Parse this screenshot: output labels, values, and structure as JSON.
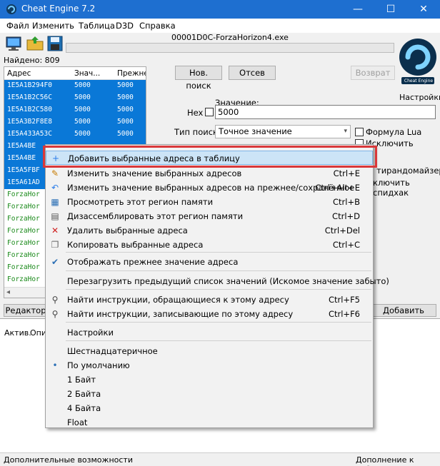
{
  "window": {
    "title": "Cheat Engine 7.2",
    "min": "—",
    "max": "☐",
    "close": "✕"
  },
  "menu": [
    "Файл",
    "Изменить",
    "Таблица",
    "D3D",
    "Справка"
  ],
  "process_name": "00001D0C-ForzaHorizon4.exe",
  "found": "Найдено: 809",
  "logo_text": "Cheat Engine",
  "settings_label": "Настройки",
  "results": {
    "headers": [
      "Адрес",
      "Знач...",
      "Прежне..."
    ],
    "rows": [
      {
        "addr": "1E5A1B294F0",
        "val": "5000",
        "prev": "5000",
        "selected": true
      },
      {
        "addr": "1E5A1B2C56C",
        "val": "5000",
        "prev": "5000",
        "selected": true
      },
      {
        "addr": "1E5A1B2C580",
        "val": "5000",
        "prev": "5000",
        "selected": true
      },
      {
        "addr": "1E5A3B2F8E8",
        "val": "5000",
        "prev": "5000",
        "selected": true
      },
      {
        "addr": "1E5A433A53C",
        "val": "5000",
        "prev": "5000",
        "selected": true
      },
      {
        "addr": "1E5A4BE",
        "val": "",
        "prev": "",
        "selected": true
      },
      {
        "addr": "1E5A4BE",
        "val": "",
        "prev": "",
        "selected": true
      },
      {
        "addr": "1E5A5FBF",
        "val": "",
        "prev": "",
        "selected": true
      },
      {
        "addr": "1E5A61AD",
        "val": "",
        "prev": "",
        "selected": true
      },
      {
        "addr": "ForzaHor",
        "val": "",
        "prev": "",
        "selected": false
      },
      {
        "addr": "ForzaHor",
        "val": "",
        "prev": "",
        "selected": false
      },
      {
        "addr": "ForzaHor",
        "val": "",
        "prev": "",
        "selected": false
      },
      {
        "addr": "ForzaHor",
        "val": "",
        "prev": "",
        "selected": false
      },
      {
        "addr": "ForzaHor",
        "val": "",
        "prev": "",
        "selected": false
      },
      {
        "addr": "ForzaHor",
        "val": "",
        "prev": "",
        "selected": false
      },
      {
        "addr": "ForzaHor",
        "val": "",
        "prev": "",
        "selected": false
      },
      {
        "addr": "ForzaHor",
        "val": "",
        "prev": "",
        "selected": false
      }
    ]
  },
  "buttons": {
    "new_scan": "Нов. поиск",
    "next_scan": "Отсев",
    "undo_scan": "Возврат",
    "editor": "Редактор",
    "add_address": "Добавить адрес"
  },
  "scan": {
    "value_label": "Значение:",
    "hex_label": "Hex",
    "value": "5000",
    "scan_type_label": "Тип поиска",
    "scan_type": "Точное значение",
    "lua_formula": "Формула Lua",
    "exclude": "Исключить",
    "randomizer": "тирандомайзер",
    "speedhack": "ключить спидхак"
  },
  "bottom": {
    "headers": [
      "Актив.",
      "Опи"
    ]
  },
  "status": {
    "left": "Дополнительные возможности",
    "right": "Дополнение к таблицу"
  },
  "context_menu": {
    "items": [
      {
        "icon": "+",
        "label": "Добавить выбранные адреса в таблицу",
        "shortcut": ""
      },
      {
        "icon": "✎",
        "label": "Изменить значение выбранных адресов",
        "shortcut": "Ctrl+E"
      },
      {
        "icon": "↶",
        "label": "Изменить значение выбранных адресов на прежнее/сохранённое",
        "shortcut": "Ctrl+Alt+E"
      },
      {
        "icon": "▦",
        "label": "Просмотреть этот регион памяти",
        "shortcut": "Ctrl+B"
      },
      {
        "icon": "▤",
        "label": "Дизассемблировать этот регион памяти",
        "shortcut": "Ctrl+D"
      },
      {
        "icon": "✕",
        "label": "Удалить выбранные адреса",
        "shortcut": "Ctrl+Del"
      },
      {
        "icon": "❐",
        "label": "Копировать выбранные адреса",
        "shortcut": "Ctrl+C"
      },
      {
        "icon": "✔",
        "label": "Отображать прежнее значение адреса",
        "shortcut": ""
      },
      {
        "icon": "",
        "label": "Перезагрузить предыдущий список значений (Искомое значение забыто)",
        "shortcut": ""
      },
      {
        "icon": "⚲",
        "label": "Найти инструкции, обращающиеся к этому адресу",
        "shortcut": "Ctrl+F5"
      },
      {
        "icon": "⚲",
        "label": "Найти инструкции, записывающие по этому адресу",
        "shortcut": "Ctrl+F6"
      },
      {
        "icon": "",
        "label": "Настройки",
        "shortcut": ""
      },
      {
        "icon": "",
        "label": "Шестнадцатеричное",
        "shortcut": ""
      },
      {
        "icon": "•",
        "label": "По умолчанию",
        "shortcut": ""
      },
      {
        "icon": "",
        "label": "1 Байт",
        "shortcut": ""
      },
      {
        "icon": "",
        "label": "2 Байта",
        "shortcut": ""
      },
      {
        "icon": "",
        "label": "4 Байта",
        "shortcut": ""
      },
      {
        "icon": "",
        "label": "Float",
        "shortcut": ""
      }
    ]
  },
  "colors": {
    "titlebar": "#1e6fd0",
    "selection": "#0a78d7",
    "highlight_border": "#d9383a",
    "pointer_green": "#1a8a1a"
  }
}
